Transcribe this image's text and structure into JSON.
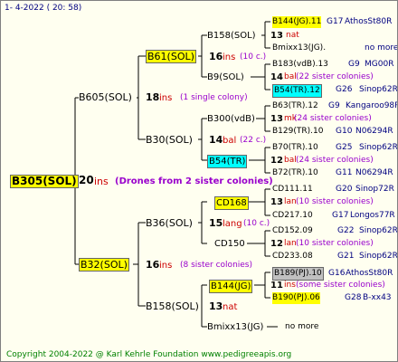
{
  "date": "1-  4-2022 ( 20: 58)",
  "root": {
    "name": "B305(SOL)",
    "num": "20",
    "ins": "ins",
    "note": "(Drones from 2 sister colonies)"
  },
  "l1": [
    {
      "name": "B605(SOL)",
      "num": "18",
      "ins": "ins",
      "note": "(1 single colony)"
    },
    {
      "name": "B32(SOL)",
      "num": "16",
      "ins": "ins",
      "note": "(8 sister colonies)"
    }
  ],
  "l2": [
    {
      "name": "B61(SOL)",
      "num": "16",
      "ins": "ins",
      "note": "(10 c.)"
    },
    {
      "name": "B30(SOL)",
      "num": "14",
      "ins": "bal",
      "note": "(22 c.)"
    },
    {
      "name": "B36(SOL)",
      "num": "15",
      "ins": "lang",
      "note": "(10 c.)"
    },
    {
      "name": "B158(SOL)",
      "num": "13",
      "ins": "nat",
      "note": ""
    }
  ],
  "l3": [
    {
      "name": "B158(SOL)",
      "num": "13",
      "ins": "nat",
      "note": ""
    },
    {
      "name": "B9(SOL)",
      "num": "14",
      "ins": "bal",
      "note": "(22 sister colonies)"
    },
    {
      "name": "B300(vdB)",
      "num": "13",
      "ins": "mk",
      "note": "(24 sister colonies)"
    },
    {
      "name": "B54(TR)",
      "num": "12",
      "ins": "bal",
      "note": "(24 sister colonies)"
    },
    {
      "name": "CD168",
      "num": "13",
      "ins": "lan",
      "note": "(10 sister colonies)"
    },
    {
      "name": "CD150",
      "num": "12",
      "ins": "lan",
      "note": "(10 sister colonies)"
    },
    {
      "name": "B144(JG)",
      "num": "11",
      "ins": "ins",
      "note": "(some sister colonies)"
    },
    {
      "name": "Bmixx13(JG)",
      "num": "",
      "ins": "",
      "note": ""
    }
  ],
  "l4": [
    {
      "name": "B144(JG).11",
      "gen": "G17",
      "src": "AthosSt80R"
    },
    {
      "name": "Bmixx13(JG).",
      "gen": "",
      "src": "no more"
    },
    {
      "name": "B183(vdB).13",
      "gen": "G9",
      "src": "MG00R"
    },
    {
      "name": "B54(TR).12",
      "gen": "G26",
      "src": "Sinop62R"
    },
    {
      "name": "B63(TR).12",
      "gen": "G9",
      "src": "Kangaroo98R"
    },
    {
      "name": "B129(TR).10",
      "gen": "G10",
      "src": "N06294R"
    },
    {
      "name": "B70(TR).10",
      "gen": "G25",
      "src": "Sinop62R"
    },
    {
      "name": "B72(TR).10",
      "gen": "G11",
      "src": "N06294R"
    },
    {
      "name": "CD111.11",
      "gen": "G20",
      "src": "Sinop72R"
    },
    {
      "name": "CD217.10",
      "gen": "G17",
      "src": "Longos77R"
    },
    {
      "name": "CD152.09",
      "gen": "G22",
      "src": "Sinop62R"
    },
    {
      "name": "CD233.08",
      "gen": "G21",
      "src": "Sinop62R"
    },
    {
      "name": "B189(PJ).10",
      "gen": "G16",
      "src": "AthosSt80R"
    },
    {
      "name": "B190(PJ).06",
      "gen": "G28",
      "src": "B-xx43"
    },
    {
      "name": "",
      "gen": "",
      "src": "no more"
    }
  ],
  "footer": "Copyright 2004-2022 @ Karl Kehrle Foundation    www.pedigreeapis.org"
}
